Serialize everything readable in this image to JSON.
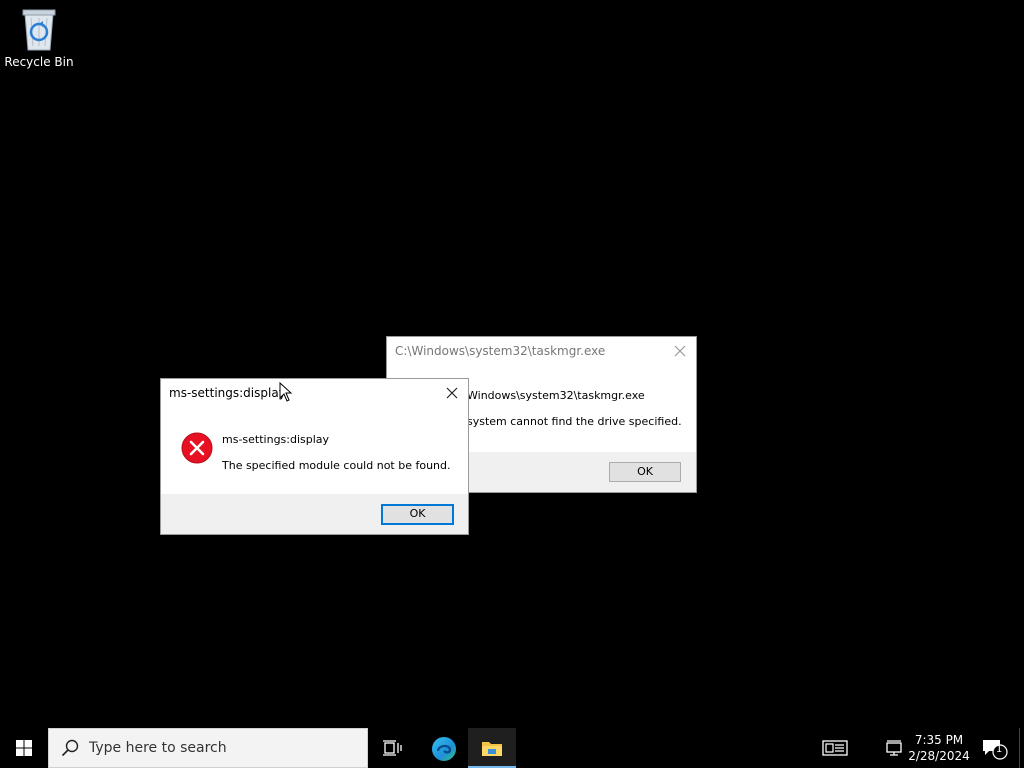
{
  "desktop": {
    "recycle_bin_label": "Recycle Bin"
  },
  "dialog_taskmgr": {
    "title": "C:\\Windows\\system32\\taskmgr.exe",
    "message_line1": "Windows\\system32\\taskmgr.exe",
    "message_line2": "system cannot find the drive specified.",
    "ok_label": "OK"
  },
  "dialog_settings": {
    "title": "ms-settings:display",
    "message_line1": "ms-settings:display",
    "message_line2": "The specified module could not be found.",
    "ok_label": "OK",
    "icon": "error-icon"
  },
  "taskbar": {
    "search_placeholder": "Type here to search",
    "time": "7:35 PM",
    "date": "2/28/2024",
    "notification_count": "1",
    "pinned": [
      "task-view",
      "edge",
      "file-explorer"
    ]
  },
  "colors": {
    "accent": "#0078d7",
    "error_red": "#e81123",
    "taskbar_active_underline": "#76b9ed"
  }
}
